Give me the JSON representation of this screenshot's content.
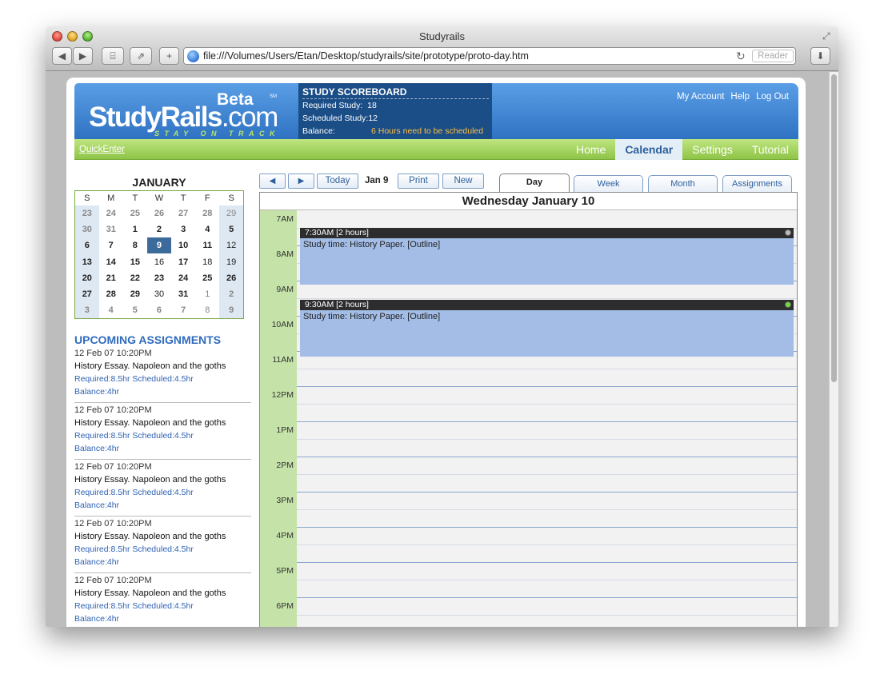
{
  "window": {
    "title": "Studyrails"
  },
  "toolbar": {
    "back": "◀",
    "forward": "▶",
    "url": "file:///Volumes/Users/Etan/Desktop/studyrails/site/prototype/proto-day.htm",
    "reader": "Reader",
    "add": "+"
  },
  "logo": {
    "study": "Study",
    "rails": "Rails",
    "dotcom": ".com",
    "beta": "Beta",
    "sm": "SM",
    "tagline": "STAY ON TRACK"
  },
  "scoreboard": {
    "title": "STUDY SCOREBOARD",
    "required_label": "Required Study:",
    "required_value": "18",
    "scheduled_label": "Scheduled Study:",
    "scheduled_value": "12",
    "balance_label": "Balance:",
    "balance_value": "6 Hours need to be scheduled"
  },
  "account_links": [
    "My Account",
    "Help",
    "Log Out"
  ],
  "nav": {
    "quick_enter": "QuickEnter",
    "tabs": [
      "Home",
      "Calendar",
      "Settings",
      "Tutorial"
    ],
    "active": "Calendar"
  },
  "mini_calendar": {
    "month": "JANUARY",
    "weekdays": [
      "S",
      "M",
      "T",
      "W",
      "T",
      "F",
      "S"
    ],
    "weeks": [
      [
        "23",
        "24",
        "25",
        "26",
        "27",
        "28",
        "29"
      ],
      [
        "30",
        "31",
        "1",
        "2",
        "3",
        "4",
        "5"
      ],
      [
        "6",
        "7",
        "8",
        "9",
        "10",
        "11",
        "12"
      ],
      [
        "13",
        "14",
        "15",
        "16",
        "17",
        "18",
        "19"
      ],
      [
        "20",
        "21",
        "22",
        "23",
        "24",
        "25",
        "26"
      ],
      [
        "27",
        "28",
        "29",
        "30",
        "31",
        "1",
        "2"
      ],
      [
        "3",
        "4",
        "5",
        "6",
        "7",
        "8",
        "9"
      ]
    ],
    "selected": "9"
  },
  "upcoming": {
    "title": "UPCOMING ASSIGNMENTS",
    "items": [
      {
        "date": "12 Feb 07 10:20PM",
        "name": "History Essay. Napoleon and the goths",
        "hours": "Required:8.5hr Scheduled:4.5hr",
        "balance": "Balance:4hr"
      },
      {
        "date": "12 Feb 07 10:20PM",
        "name": "History Essay. Napoleon and the goths",
        "hours": "Required:8.5hr Scheduled:4.5hr",
        "balance": "Balance:4hr"
      },
      {
        "date": "12 Feb 07 10:20PM",
        "name": "History Essay. Napoleon and the goths",
        "hours": "Required:8.5hr Scheduled:4.5hr",
        "balance": "Balance:4hr"
      },
      {
        "date": "12 Feb 07 10:20PM",
        "name": "History Essay. Napoleon and the goths",
        "hours": "Required:8.5hr Scheduled:4.5hr",
        "balance": "Balance:4hr"
      },
      {
        "date": "12 Feb 07 10:20PM",
        "name": "History Essay. Napoleon and the goths",
        "hours": "Required:8.5hr Scheduled:4.5hr",
        "balance": "Balance:4hr"
      }
    ]
  },
  "day_controls": {
    "prev": "◀",
    "next": "▶",
    "today": "Today",
    "current": "Jan 9",
    "print": "Print",
    "new": "New"
  },
  "view_tabs": {
    "items": [
      "Day",
      "Week",
      "Month",
      "Assignments"
    ],
    "active": "Day"
  },
  "day_view": {
    "title": "Wednesday January 10",
    "hours": [
      "7AM",
      "8AM",
      "9AM",
      "10AM",
      "11AM",
      "12PM",
      "1PM",
      "2PM",
      "3PM",
      "4PM",
      "5PM",
      "6PM"
    ],
    "events": [
      {
        "time": "7:30AM [2 hours]",
        "text": "Study time: History Paper. [Outline]",
        "status": "grey"
      },
      {
        "time": "9:30AM [2 hours]",
        "text": "Study time: History Paper. [Outline]",
        "status": "green"
      }
    ]
  },
  "colors": {
    "header_blue": "#2f72c2",
    "nav_green": "#8dc447",
    "event_blue": "#a3bde6",
    "hour_column": "#c5e2a8",
    "warning": "#ffc040"
  }
}
